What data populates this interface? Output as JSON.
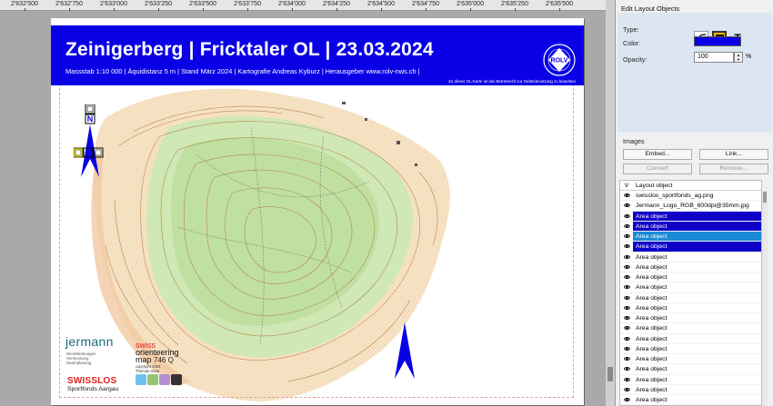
{
  "ruler": {
    "ticks": [
      "2'632'500",
      "2'632'750",
      "2'633'000",
      "2'633'250",
      "2'633'500",
      "2'633'750",
      "2'634'000",
      "2'634'250",
      "2'634'500",
      "2'634'750",
      "2'635'000",
      "2'635'250",
      "2'635'500"
    ]
  },
  "map_sheet": {
    "title": "Zeinigerberg | Fricktaler OL | 23.03.2024",
    "subtitle": "Massstab 1:10 000 | Äquidistanz 5 m | Stand März 2024 | Kartografie Andreas Kyburz | Herausgeber www.rolv-nws.ch |",
    "note": "Zu dieser OL-Karte ist das Betretrecht zur Geländenutzung zu beachten",
    "logo_text": "ROLV",
    "logo_ring": "Regionalverband Nordwestschweiz",
    "sponsor1": "jermann",
    "sponsor1_sub": [
      "Dienstleistungen",
      "Vermessung",
      "Raumplanung"
    ],
    "sponsor2": "SWISSLOS",
    "sponsor2_sub": "Sportfonds Aargau",
    "so_line1": "swiss",
    "so_line2": "orienteering",
    "so_map": "map",
    "so_number": "746 Q",
    "so_small": [
      "copyright 2024",
      "Thomas Gloor"
    ],
    "north_label": "N",
    "header_color": "#0a00e6"
  },
  "panel": {
    "title": "Edit Layout Objects",
    "type_label": "Type:",
    "text_type_glyph": "T",
    "color_label": "Color:",
    "color_value": "#0a00e6",
    "opacity_label": "Opacity:",
    "opacity_value": "100",
    "opacity_unit": "%",
    "images_label": "Images",
    "buttons": {
      "embed": "Embed...",
      "link": "Link...",
      "convert": "Convert",
      "remove": "Remove..."
    },
    "list_header_v": "V",
    "list_header_name": "Layout object",
    "list_items": [
      {
        "label": "swisslos_sportfonds_ag.png",
        "state": "none"
      },
      {
        "label": "Jermann_Logo_RGB_600dpi@35mm.jpg",
        "state": "none"
      },
      {
        "label": "Area object",
        "state": "selected"
      },
      {
        "label": "Area object",
        "state": "selected"
      },
      {
        "label": "Area object",
        "state": "current"
      },
      {
        "label": "Area object",
        "state": "selected"
      },
      {
        "label": "Area object",
        "state": "none"
      },
      {
        "label": "Area object",
        "state": "none"
      },
      {
        "label": "Area object",
        "state": "none"
      },
      {
        "label": "Area object",
        "state": "none"
      },
      {
        "label": "Area object",
        "state": "none"
      },
      {
        "label": "Area object",
        "state": "none"
      },
      {
        "label": "Area object",
        "state": "none"
      },
      {
        "label": "Area object",
        "state": "none"
      },
      {
        "label": "Area object",
        "state": "none"
      },
      {
        "label": "Area object",
        "state": "none"
      },
      {
        "label": "Area object",
        "state": "none"
      },
      {
        "label": "Area object",
        "state": "none"
      },
      {
        "label": "Area object",
        "state": "none"
      },
      {
        "label": "Area object",
        "state": "none"
      },
      {
        "label": "Area object",
        "state": "none"
      }
    ]
  }
}
